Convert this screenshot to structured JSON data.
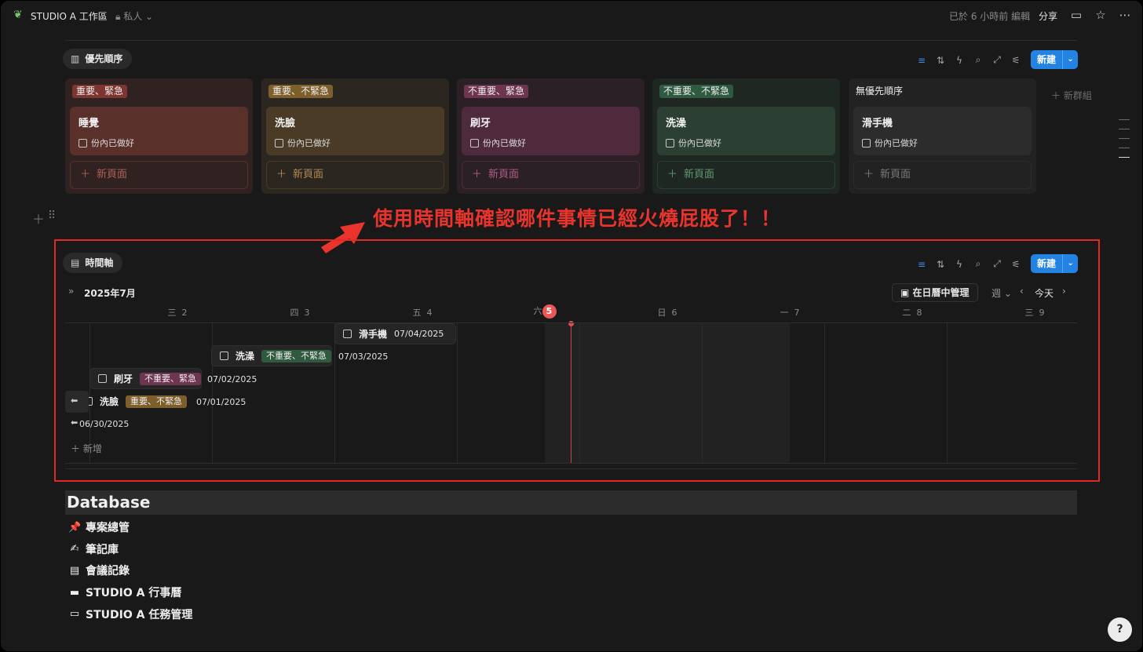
{
  "topbar": {
    "workspace_icon": "leaf-icon",
    "workspace_title": "STUDIO A 工作區",
    "privacy": "私人",
    "edited": "已於 6 小時前 編輯",
    "share": "分享"
  },
  "board_view": {
    "tab_label": "優先順序",
    "new_label": "新建",
    "new_group": "新群組",
    "columns": [
      {
        "tag": "重要、緊急",
        "card_title": "睡覺",
        "card_check": "份內已做好",
        "new_page": "新頁面",
        "colors": {
          "col": "#2f2220",
          "card": "#5a302b",
          "tag": "#7d3530",
          "np": "#b0605a"
        }
      },
      {
        "tag": "重要、不緊急",
        "card_title": "洗臉",
        "card_check": "份內已做好",
        "new_page": "新頁面",
        "colors": {
          "col": "#2b2620",
          "card": "#4a3b27",
          "tag": "#7d5f2c",
          "np": "#b38a52"
        }
      },
      {
        "tag": "不重要、緊急",
        "card_title": "刷牙",
        "card_check": "份內已做好",
        "new_page": "新頁面",
        "colors": {
          "col": "#2b2026",
          "card": "#4f2a3d",
          "tag": "#6e3550",
          "np": "#b05b86"
        }
      },
      {
        "tag": "不重要、不緊急",
        "card_title": "洗澡",
        "card_check": "份內已做好",
        "new_page": "新頁面",
        "colors": {
          "col": "#1f2723",
          "card": "#2b4033",
          "tag": "#2f5a40",
          "np": "#5f9a70"
        }
      },
      {
        "tag": "無優先順序",
        "card_title": "滑手機",
        "card_check": "份內已做好",
        "new_page": "新頁面",
        "colors": {
          "col": "#222222",
          "card": "#2c2c2c",
          "tag": "transparent",
          "np": "#7a7a7a"
        }
      }
    ]
  },
  "annotation": "使用時間軸確認哪件事情已經火燒屁股了！！",
  "timeline_view": {
    "tab_label": "時間軸",
    "new_label": "新建",
    "month": "2025年7月",
    "calendar_button": "在日曆中管理",
    "range": "週",
    "today": "今天",
    "days": [
      {
        "wd": "三",
        "d": "2"
      },
      {
        "wd": "四",
        "d": "3"
      },
      {
        "wd": "五",
        "d": "4"
      },
      {
        "wd": "六",
        "d": "5"
      },
      {
        "wd": "日",
        "d": "6"
      },
      {
        "wd": "一",
        "d": "7"
      },
      {
        "wd": "二",
        "d": "8"
      },
      {
        "wd": "三",
        "d": "9"
      }
    ],
    "items": [
      {
        "name": "滑手機",
        "tag": "",
        "date": "07/04/2025"
      },
      {
        "name": "洗澡",
        "tag": "不重要、不緊急",
        "date": "07/03/2025"
      },
      {
        "name": "刷牙",
        "tag": "不重要、緊急",
        "date": "07/02/2025"
      },
      {
        "name": "洗臉",
        "tag": "重要、不緊急",
        "date": "07/01/2025"
      }
    ],
    "offscreen_date": "06/30/2025",
    "add_label": "新增"
  },
  "database": {
    "title": "Database",
    "items": [
      {
        "icon": "pushpin-icon",
        "glyph": "📌",
        "label": "專案總管"
      },
      {
        "icon": "writing-hand-icon",
        "glyph": "✍",
        "label": "筆記庫"
      },
      {
        "icon": "table-icon",
        "glyph": "▤",
        "label": "會議記錄"
      },
      {
        "icon": "laptop-icon",
        "glyph": "▬",
        "label": "STUDIO A 行事曆"
      },
      {
        "icon": "notepad-icon",
        "glyph": "▭",
        "label": "STUDIO A 任務管理"
      }
    ]
  }
}
